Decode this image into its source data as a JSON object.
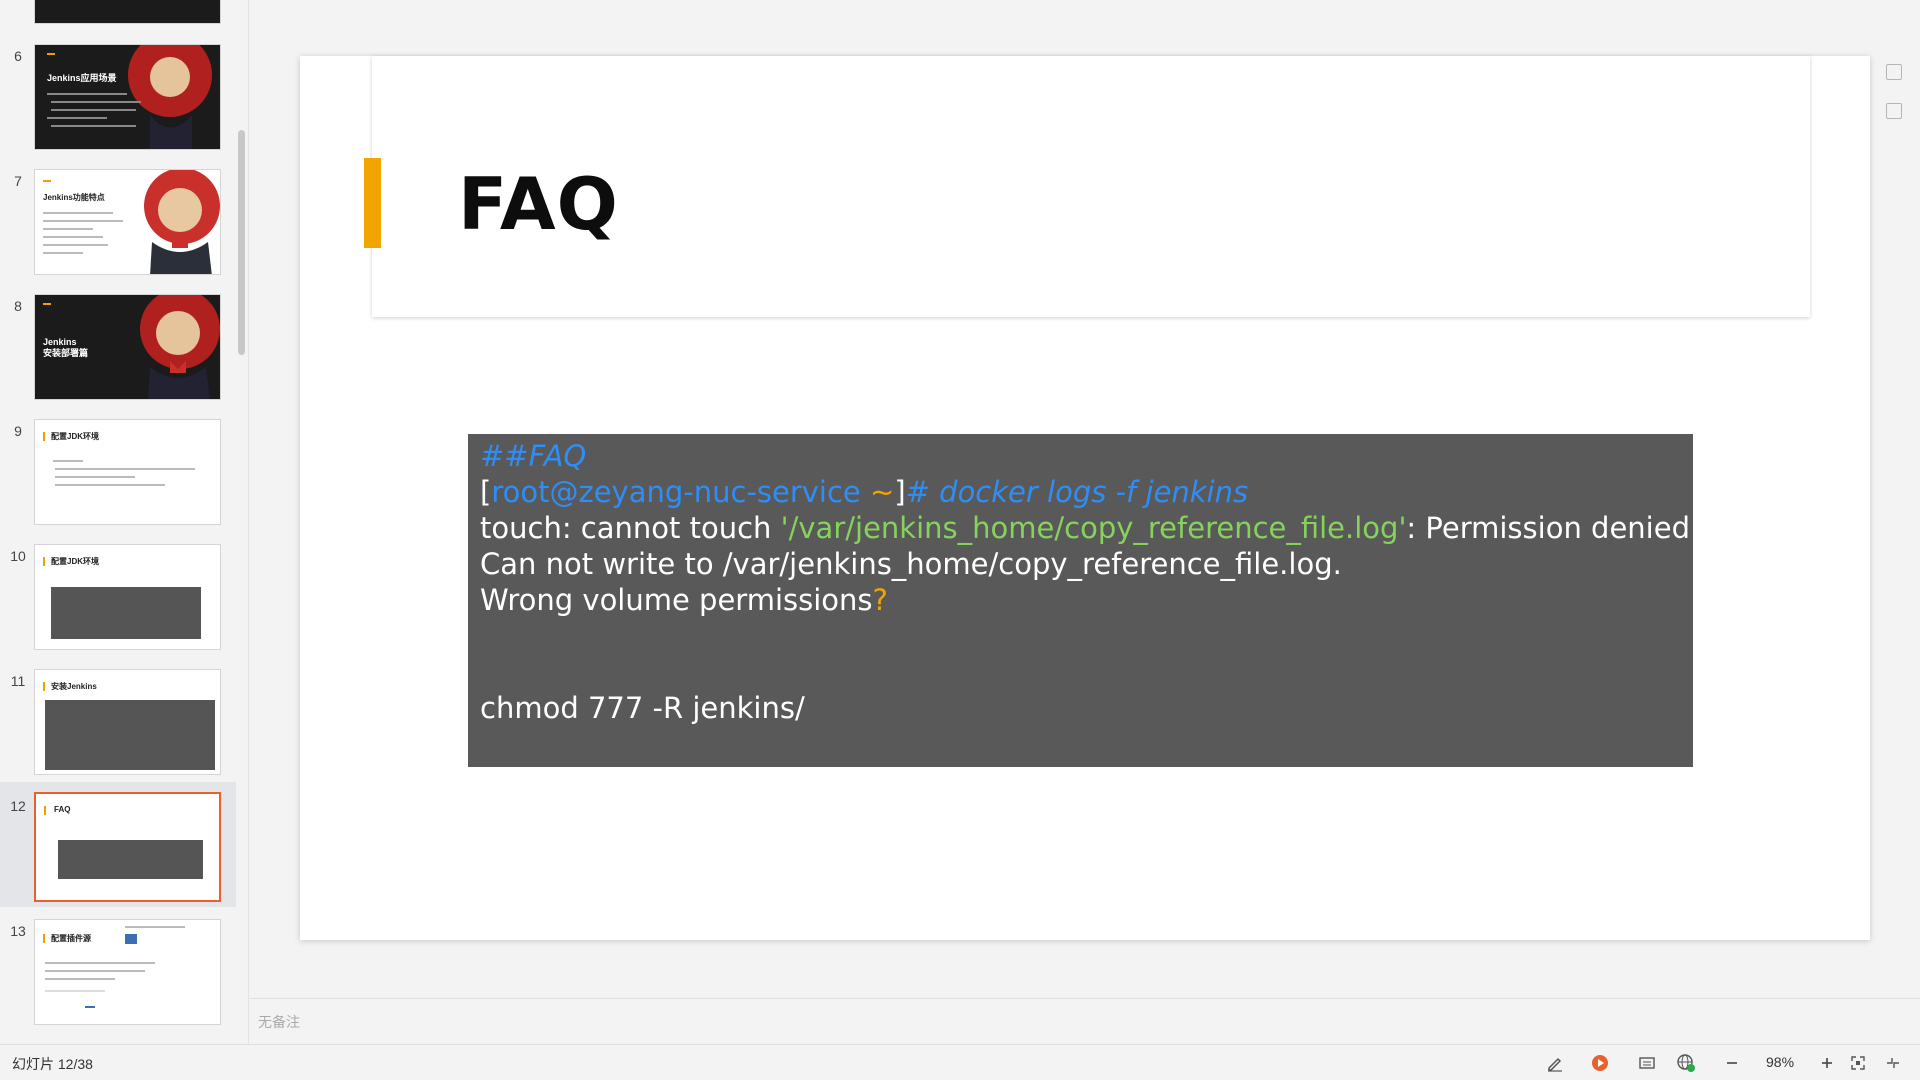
{
  "thumbnails": [
    {
      "number": "6",
      "title": "Jenkins应用场景"
    },
    {
      "number": "7",
      "title": "Jenkins功能特点"
    },
    {
      "number": "8",
      "title": "Jenkins\n安装部署篇"
    },
    {
      "number": "9",
      "title": "配置JDK环境"
    },
    {
      "number": "10",
      "title": "配置JDK环境"
    },
    {
      "number": "11",
      "title": "安装Jenkins"
    },
    {
      "number": "12",
      "title": "FAQ"
    },
    {
      "number": "13",
      "title": "配置插件源"
    }
  ],
  "slide": {
    "title": "FAQ",
    "code": {
      "heading": "##FAQ",
      "prompt_open": "[",
      "prompt_host": "root@zeyang-nuc-service",
      "prompt_tilde": " ~",
      "prompt_close": "]",
      "command": "# docker logs -f jenkins",
      "error_prefix": "touch: cannot touch ",
      "error_path": "'/var/jenkins_home/copy_reference_file.log'",
      "error_suffix": ": Permission denied",
      "wrong_text": "Can not write to /var/jenkins_home/copy_reference_file.log. Wrong volume permissions",
      "wrong_qmark": "?",
      "fix": "chmod 777 -R jenkins/"
    }
  },
  "notes_placeholder": "无备注",
  "status_bar": {
    "slide_count": "幻灯片 12/38",
    "zoom": "98%"
  },
  "colors": {
    "accent": "#f0a500",
    "selected_border": "#e8602c",
    "code_bg": "#595959",
    "code_blue": "#2e8ef5",
    "code_green": "#86d35c"
  }
}
